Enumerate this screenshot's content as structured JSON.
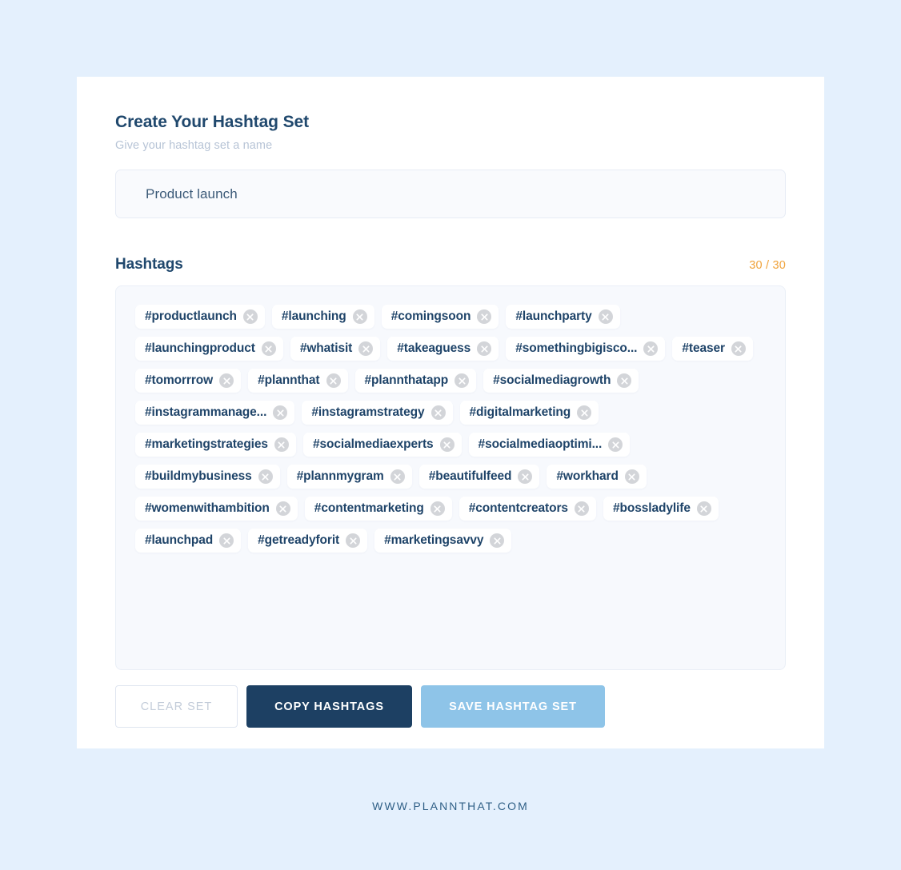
{
  "page": {
    "background_color": "#e4f0fd",
    "card_background": "#ffffff"
  },
  "card": {
    "title": "Create Your Hashtag Set",
    "subtitle": "Give your hashtag set a name"
  },
  "name_input": {
    "value": "Product launch",
    "placeholder": "Give your hashtag set a name"
  },
  "hashtags_section": {
    "label": "Hashtags",
    "count_text": "30 / 30",
    "count_color": "#f0a33c",
    "remove_icon": "close-circle-icon",
    "tags": [
      "#productlaunch",
      "#launching",
      "#comingsoon",
      "#launchparty",
      "#launchingproduct",
      "#whatisit",
      "#takeaguess",
      "#somethingbigisco...",
      "#teaser",
      "#tomorrrow",
      "#plannthat",
      "#plannthatapp",
      "#socialmediagrowth",
      "#instagrammanage...",
      "#instagramstrategy",
      "#digitalmarketing",
      "#marketingstrategies",
      "#socialmediaexperts",
      "#socialmediaoptimi...",
      "#buildmybusiness",
      "#plannmygram",
      "#beautifulfeed",
      "#workhard",
      "#womenwithambition",
      "#contentmarketing",
      "#contentcreators",
      "#bossladylife",
      "#launchpad",
      "#getreadyforit",
      "#marketingsavvy"
    ]
  },
  "actions": {
    "clear_label": "CLEAR SET",
    "copy_label": "COPY HASHTAGS",
    "save_label": "SAVE HASHTAG SET",
    "copy_color": "#1d4063",
    "save_color": "#8ec4e8"
  },
  "footer": {
    "text": "WWW.PLANNTHAT.COM"
  }
}
